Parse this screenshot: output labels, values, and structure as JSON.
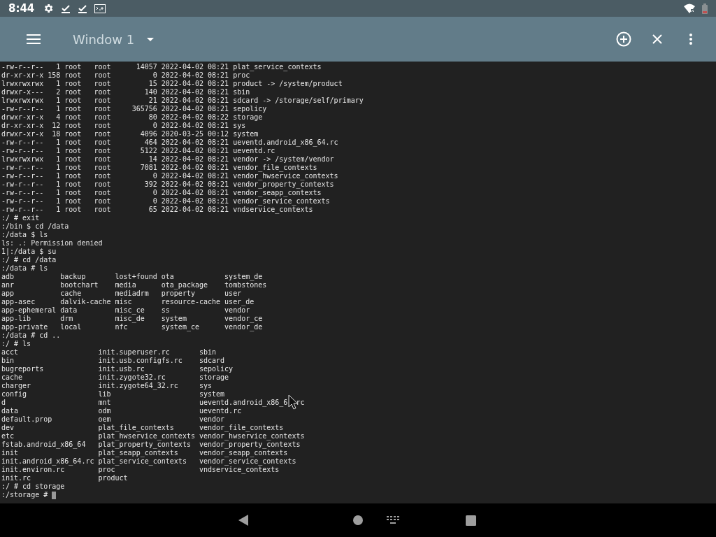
{
  "status_bar": {
    "time": "8:44"
  },
  "toolbar": {
    "title": "Window 1"
  },
  "terminal": {
    "blocks": [
      {
        "kind": "long",
        "rows": [
          [
            "-rw-r--r--",
            "1",
            "root",
            "root",
            "14057",
            "2022-04-02",
            "08:21",
            "plat_service_contexts"
          ],
          [
            "dr-xr-xr-x",
            "158",
            "root",
            "root",
            "0",
            "2022-04-02",
            "08:21",
            "proc"
          ],
          [
            "lrwxrwxrwx",
            "1",
            "root",
            "root",
            "15",
            "2022-04-02",
            "08:21",
            "product -> /system/product"
          ],
          [
            "drwxr-x---",
            "2",
            "root",
            "root",
            "140",
            "2022-04-02",
            "08:21",
            "sbin"
          ],
          [
            "lrwxrwxrwx",
            "1",
            "root",
            "root",
            "21",
            "2022-04-02",
            "08:21",
            "sdcard -> /storage/self/primary"
          ],
          [
            "-rw-r--r--",
            "1",
            "root",
            "root",
            "365756",
            "2022-04-02",
            "08:21",
            "sepolicy"
          ],
          [
            "drwxr-xr-x",
            "4",
            "root",
            "root",
            "80",
            "2022-04-02",
            "08:22",
            "storage"
          ],
          [
            "dr-xr-xr-x",
            "12",
            "root",
            "root",
            "0",
            "2022-04-02",
            "08:21",
            "sys"
          ],
          [
            "drwxr-xr-x",
            "18",
            "root",
            "root",
            "4096",
            "2020-03-25",
            "00:12",
            "system"
          ],
          [
            "-rw-r--r--",
            "1",
            "root",
            "root",
            "464",
            "2022-04-02",
            "08:21",
            "ueventd.android_x86_64.rc"
          ],
          [
            "-rw-r--r--",
            "1",
            "root",
            "root",
            "5122",
            "2022-04-02",
            "08:21",
            "ueventd.rc"
          ],
          [
            "lrwxrwxrwx",
            "1",
            "root",
            "root",
            "14",
            "2022-04-02",
            "08:21",
            "vendor -> /system/vendor"
          ],
          [
            "-rw-r--r--",
            "1",
            "root",
            "root",
            "7081",
            "2022-04-02",
            "08:21",
            "vendor_file_contexts"
          ],
          [
            "-rw-r--r--",
            "1",
            "root",
            "root",
            "0",
            "2022-04-02",
            "08:21",
            "vendor_hwservice_contexts"
          ],
          [
            "-rw-r--r--",
            "1",
            "root",
            "root",
            "392",
            "2022-04-02",
            "08:21",
            "vendor_property_contexts"
          ],
          [
            "-rw-r--r--",
            "1",
            "root",
            "root",
            "0",
            "2022-04-02",
            "08:21",
            "vendor_seapp_contexts"
          ],
          [
            "-rw-r--r--",
            "1",
            "root",
            "root",
            "0",
            "2022-04-02",
            "08:21",
            "vendor_service_contexts"
          ],
          [
            "-rw-r--r--",
            "1",
            "root",
            "root",
            "65",
            "2022-04-02",
            "08:21",
            "vndservice_contexts"
          ]
        ]
      },
      {
        "kind": "text",
        "lines": [
          ":/ # exit",
          ":/bin $ cd /data",
          ":/data $ ls",
          "ls: .: Permission denied",
          "1|:/data $ su",
          ":/ # cd /data",
          ":/data # ls"
        ]
      },
      {
        "kind": "columns",
        "rows": [
          [
            "adb",
            "backup",
            "lost+found",
            "ota",
            "system_de"
          ],
          [
            "anr",
            "bootchart",
            "media",
            "ota_package",
            "tombstones"
          ],
          [
            "app",
            "cache",
            "mediadrm",
            "property",
            "user"
          ],
          [
            "app-asec",
            "dalvik-cache",
            "misc",
            "resource-cache",
            "user_de"
          ],
          [
            "app-ephemeral",
            "data",
            "misc_ce",
            "ss",
            "vendor"
          ],
          [
            "app-lib",
            "drm",
            "misc_de",
            "system",
            "vendor_ce"
          ],
          [
            "app-private",
            "local",
            "nfc",
            "system_ce",
            "vendor_de"
          ]
        ]
      },
      {
        "kind": "text",
        "lines": [
          ":/data # cd ..",
          ":/ # ls"
        ]
      },
      {
        "kind": "columns",
        "rows": [
          [
            "acct",
            "init.superuser.rc",
            "sbin"
          ],
          [
            "bin",
            "init.usb.configfs.rc",
            "sdcard"
          ],
          [
            "bugreports",
            "init.usb.rc",
            "sepolicy"
          ],
          [
            "cache",
            "init.zygote32.rc",
            "storage"
          ],
          [
            "charger",
            "init.zygote64_32.rc",
            "sys"
          ],
          [
            "config",
            "lib",
            "system"
          ],
          [
            "d",
            "mnt",
            [
              "ueventd.android_x86_6",
              "rc"
            ]
          ],
          [
            "data",
            "odm",
            "ueventd.rc"
          ],
          [
            "default.prop",
            "oem",
            "vendor"
          ],
          [
            "dev",
            "plat_file_contexts",
            "vendor_file_contexts"
          ],
          [
            "etc",
            "plat_hwservice_contexts",
            "vendor_hwservice_contexts"
          ],
          [
            "fstab.android_x86_64",
            "plat_property_contexts",
            "vendor_property_contexts"
          ],
          [
            "init",
            "plat_seapp_contexts",
            "vendor_seapp_contexts"
          ],
          [
            "init.android_x86_64.rc",
            "plat_service_contexts",
            "vendor_service_contexts"
          ],
          [
            "init.environ.rc",
            "proc",
            "vndservice_contexts"
          ],
          [
            "init.rc",
            "product"
          ]
        ]
      },
      {
        "kind": "text",
        "lines": [
          ":/ # cd storage"
        ]
      },
      {
        "kind": "prompt",
        "text": ":/storage #"
      }
    ]
  }
}
